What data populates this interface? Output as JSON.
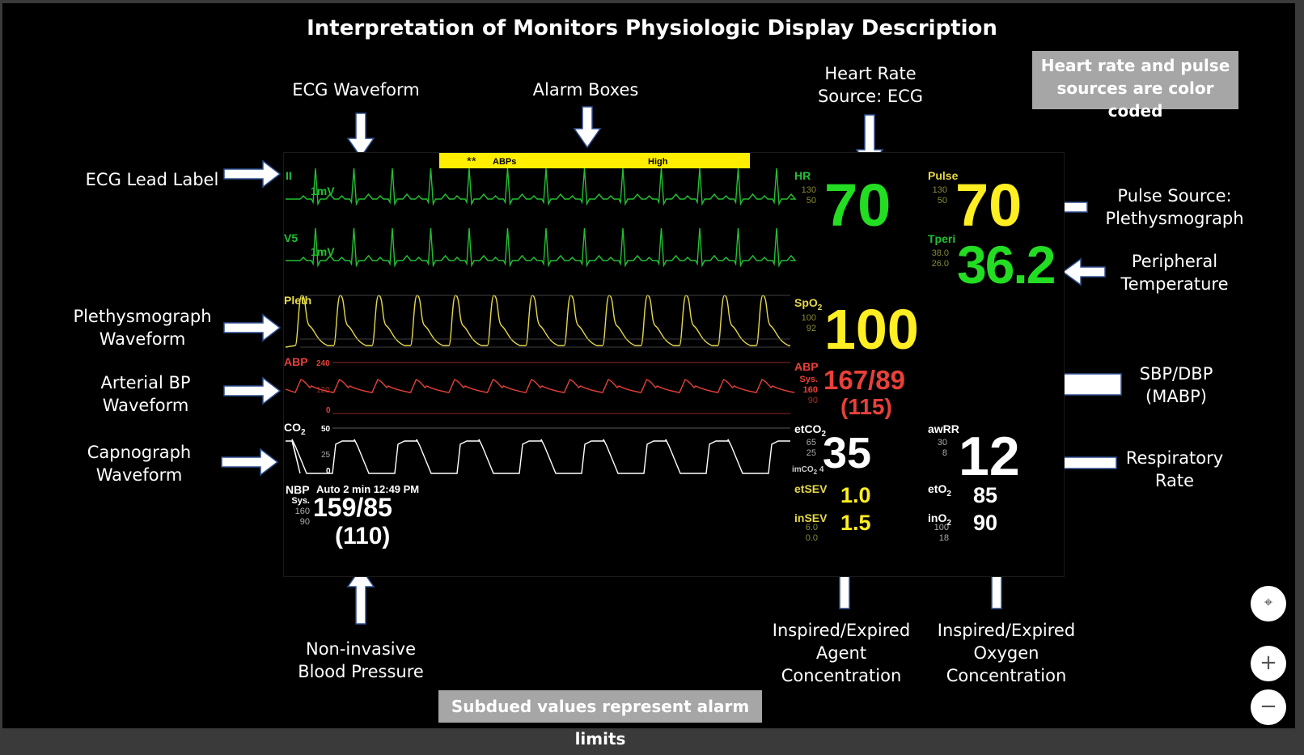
{
  "title": "Interpretation of Monitors Physiologic Display Description",
  "note_top": [
    "Heart rate and pulse",
    "sources are color coded"
  ],
  "note_bottom": "Subdued values represent alarm limits",
  "labels": {
    "ecg_waveform": "ECG Waveform",
    "alarm_boxes": "Alarm Boxes",
    "hr_source": [
      "Heart Rate",
      "Source: ECG"
    ],
    "ecg_lead": "ECG Lead Label",
    "pleth_wave": [
      "Plethysmograph",
      "Waveform"
    ],
    "abp_wave": [
      "Arterial BP",
      "Waveform"
    ],
    "capno_wave": [
      "Capnograph",
      "Waveform"
    ],
    "pulse_source": [
      "Pulse Source:",
      "Plethysmograph"
    ],
    "peripheral_temp": [
      "Peripheral",
      "Temperature"
    ],
    "sbp_dbp": [
      "SBP/DBP",
      "(MABP)"
    ],
    "resp_rate": [
      "Respiratory",
      "Rate"
    ],
    "nibp": [
      "Non-invasive",
      "Blood Pressure"
    ],
    "agent": [
      "Inspired/Expired",
      "Agent",
      "Concentration"
    ],
    "oxygen": [
      "Inspired/Expired",
      "Oxygen",
      "Concentration"
    ]
  },
  "monitor": {
    "alarm": {
      "stars": "**",
      "param": "ABPs",
      "level": "High"
    },
    "ecg1": {
      "lead": "II",
      "scale": "1mV"
    },
    "ecg2": {
      "lead": "V5",
      "scale": "1mV"
    },
    "pleth": {
      "label": "Pleth"
    },
    "abp_wave": {
      "label": "ABP",
      "top": "240",
      "mid": "120",
      "zero": "0"
    },
    "co2_wave": {
      "label": "CO",
      "sub": "2",
      "top": "50",
      "mid": "25",
      "zero": "0"
    },
    "hr": {
      "label": "HR",
      "hi": "130",
      "lo": "50",
      "value": "70"
    },
    "pulse": {
      "label": "Pulse",
      "hi": "130",
      "lo": "50",
      "value": "70"
    },
    "tperi": {
      "label": "Tperi",
      "hi": "38.0",
      "lo": "26.0",
      "value": "36.2"
    },
    "spo2": {
      "label": "SpO",
      "sub": "2",
      "hi": "100",
      "lo": "92",
      "value": "100"
    },
    "abp": {
      "label": "ABP",
      "sys": "Sys.",
      "hi": "160",
      "lo": "90",
      "value": "167/89",
      "mean": "(115)"
    },
    "etco2": {
      "label": "etCO",
      "sub": "2",
      "hi": "65",
      "lo": "25",
      "value": "35",
      "imco2_label": "imCO",
      "imco2_sub": "2",
      "imco2": "4"
    },
    "awrr": {
      "label": "awRR",
      "hi": "30",
      "lo": "8",
      "value": "12"
    },
    "nbp": {
      "label": "NBP",
      "mode": "Auto 2 min 12:49 PM",
      "sys": "Sys.",
      "hi": "160",
      "lo": "90",
      "value": "159/85",
      "mean": "(110)"
    },
    "etsev": {
      "label": "etSEV",
      "value": "1.0"
    },
    "insev": {
      "label": "inSEV",
      "hi": "6.0",
      "lo": "0.0",
      "value": "1.5"
    },
    "eto2": {
      "label": "etO",
      "sub": "2",
      "value": "85"
    },
    "ino2": {
      "label": "inO",
      "sub": "2",
      "hi": "100",
      "lo": "18",
      "value": "90"
    }
  },
  "colors": {
    "ecg": "#22c033",
    "pleth": "#e6d84a",
    "abp": "#e8403a",
    "co2": "#ffffff",
    "alarm": "#ffee00",
    "limit": "#8a8a3a"
  }
}
